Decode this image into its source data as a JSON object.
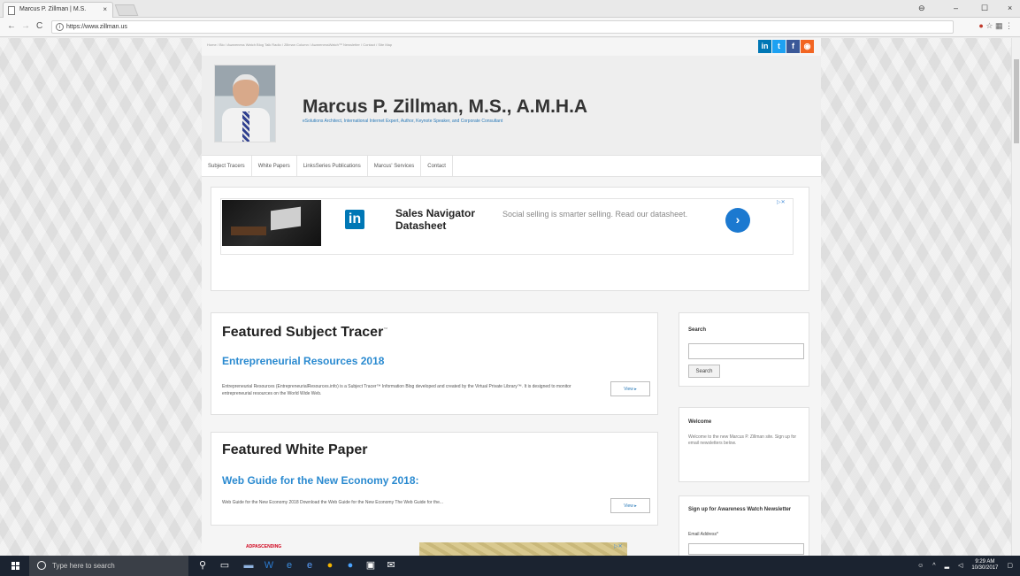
{
  "browser": {
    "tab_title": "Marcus P. Zillman | M.S.",
    "tab_close": "×",
    "url": "https://www.zillman.us",
    "back": "←",
    "forward": "→",
    "reload": "C",
    "minimize": "–",
    "maximize": "☐",
    "close": "×",
    "user_icon": "⊖"
  },
  "site": {
    "breadcrumbs": "Home / Bio / Awareness Watch Blog Talk Radio / Zillman Column / AwarenessWatch™ Newsletter / Contact / Site Map",
    "title": "Marcus P. Zillman, M.S., A.M.H.A",
    "subtitle": "eSolutions Architect, International Internet Expert, Author, Keynote Speaker, and Corporate Consultant",
    "social": {
      "linkedin": "in",
      "twitter": "t",
      "facebook": "f",
      "rss": "◉"
    },
    "nav": [
      "Subject Tracers",
      "White Papers",
      "LinksSeries Publications",
      "Marcus' Services",
      "Contact"
    ]
  },
  "ad": {
    "title": "Sales Navigator Datasheet",
    "text": "Social selling is smarter selling. Read our datasheet.",
    "logo": "in",
    "arrow": "›",
    "choice": "▷✕"
  },
  "featured_tracer": {
    "heading": "Featured Subject Tracer",
    "tm": "™",
    "link": "Entrepreneurial Resources 2018",
    "desc": "Entrepreneurial Resources (EntrepreneurialResources.info) is a Subject Tracer™ Information Blog developed and created by the Virtual Private Library™. It is designed to monitor entrepreneurial resources on the World Wide Web.",
    "view": "View ▸"
  },
  "featured_paper": {
    "heading": "Featured White Paper",
    "link": "Web Guide for the New Economy 2018:",
    "desc": "Web Guide for the New Economy 2018 Download the Web Guide for the New Economy The Web Guide for the...",
    "view": "View ▸"
  },
  "sidebar": {
    "search_title": "Search",
    "search_button": "Search",
    "welcome_title": "Welcome",
    "welcome_text": "Welcome to the new Marcus P. Zillman site. Sign up for email newsletters below.",
    "signup_title": "Sign up for Awareness Watch Newsletter",
    "email_label": "Email Address*"
  },
  "ad2": {
    "logo": "ADPASCENDING",
    "choice": "▷✕"
  },
  "taskbar": {
    "search_placeholder": "Type here to search",
    "time": "9:29 AM",
    "date": "10/30/2017"
  }
}
